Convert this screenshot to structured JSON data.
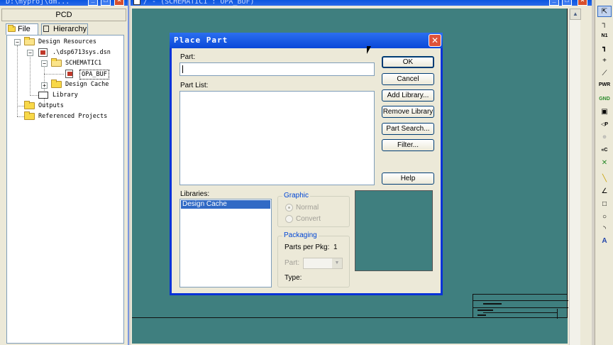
{
  "project_window": {
    "title": "D:\\myproj\\dm...",
    "panel_title": "PCD",
    "tabs": [
      {
        "label": "File"
      },
      {
        "label": "Hierarchy"
      }
    ],
    "tree": [
      {
        "label": "Design Resources"
      },
      {
        "label": ".\\dsp6713sys.dsn"
      },
      {
        "label": "SCHEMATIC1"
      },
      {
        "label": "OPA_BUF"
      },
      {
        "label": "Design Cache"
      },
      {
        "label": "Library"
      },
      {
        "label": "Outputs"
      },
      {
        "label": "Referenced Projects"
      }
    ]
  },
  "schematic_window": {
    "title": "/ - (SCHEMATIC1 : OPA_BUF)"
  },
  "dialog": {
    "title": "Place Part",
    "close_label": "✕",
    "part_label": "Part:",
    "part_value": "",
    "part_list_label": "Part List:",
    "libraries_label": "Libraries:",
    "libraries": [
      "Design Cache"
    ],
    "buttons": {
      "ok": "OK",
      "cancel": "Cancel",
      "add_library": "Add Library...",
      "remove_library": "Remove Library",
      "part_search": "Part Search...",
      "filter": "Filter...",
      "help": "Help"
    },
    "graphic": {
      "title": "Graphic",
      "normal": "Normal",
      "convert": "Convert"
    },
    "packaging": {
      "title": "Packaging",
      "parts_per_pkg_label": "Parts per Pkg:",
      "parts_per_pkg_value": "1",
      "part_label": "Part:",
      "type_label": "Type:"
    }
  },
  "palette": {
    "tools": [
      "select-icon",
      "wire-icon",
      "net-alias-icon",
      "bus-icon",
      "junction-icon",
      "bus-entry-icon",
      "power-icon",
      "ground-icon",
      "hierarchical-block-icon",
      "hierarchical-port-icon",
      "hierarchical-pin-icon",
      "off-page-connector-icon",
      "no-connect-icon",
      "line-icon",
      "polyline-icon",
      "rectangle-icon",
      "ellipse-icon",
      "arc-icon",
      "text-icon"
    ],
    "labels": {
      "power": "PWR",
      "ground": "GND",
      "net": "N1"
    }
  },
  "colors": {
    "canvas": "#3f7f7f",
    "titlebar": "#0a48d8",
    "close": "#e0533a"
  }
}
